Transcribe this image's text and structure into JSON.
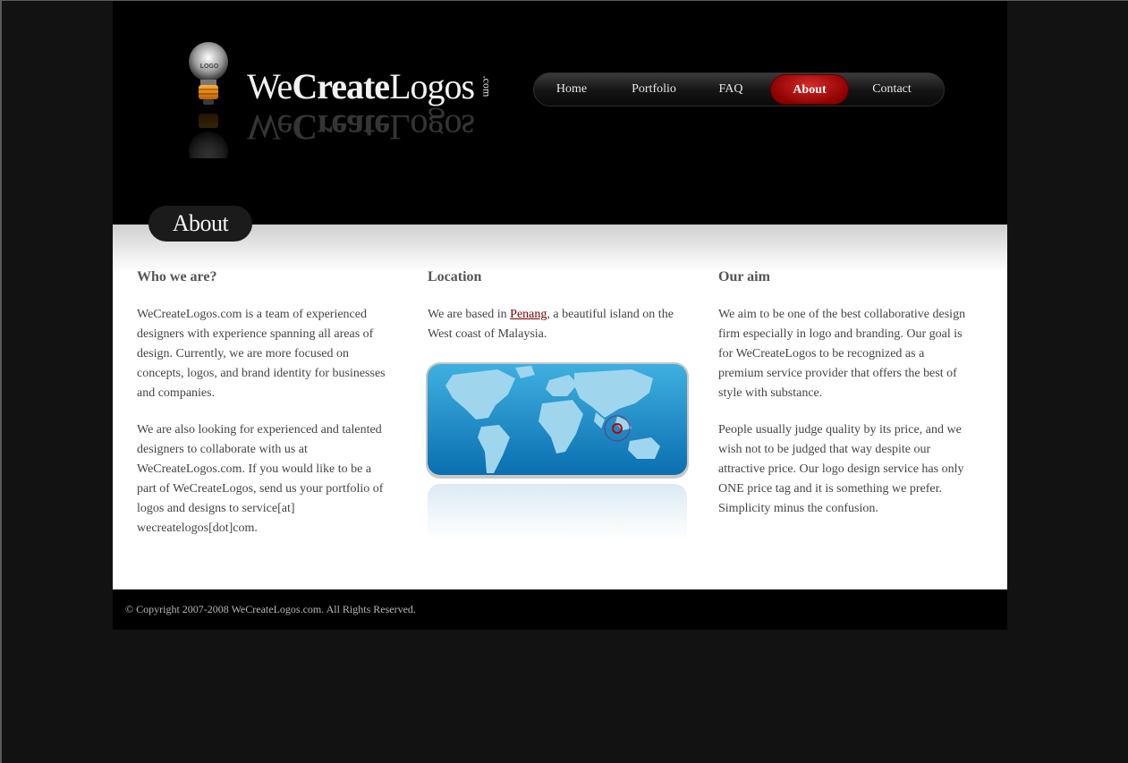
{
  "logo": {
    "text_regular_1": "We",
    "text_bold": "Create",
    "text_regular_2": "Logos",
    "text_com": ".com",
    "bulb_label": "LOGO"
  },
  "nav": {
    "items": [
      {
        "label": "Home"
      },
      {
        "label": "Portfolio"
      },
      {
        "label": "FAQ"
      },
      {
        "label": "About",
        "active": true
      },
      {
        "label": "Contact"
      }
    ]
  },
  "page_tab": "About",
  "columns": {
    "who": {
      "title": "Who we are?",
      "p1": "WeCreateLogos.com is a team of experienced designers with experience spanning all areas of design. Currently, we are more focused on concepts, logos, and brand identity for businesses and companies.",
      "p2": "We are also looking for experienced and talented designers to collaborate with us at WeCreateLogos.com. If you would like to be a part of WeCreateLogos, send us your portfolio of logos and designs to service[at] wecreatelogos[dot]com."
    },
    "location": {
      "title": "Location",
      "p1_before": "We are based in ",
      "p1_link": "Penang",
      "p1_after": ", a beautiful island on the West coast of Malaysia."
    },
    "aim": {
      "title": "Our aim",
      "p1": "We aim to be one of the best collaborative design firm especially in logo and branding. Our goal is for WeCreateLogos to be recognized as a premium service provider that offers the best of style with substance.",
      "p2": "People usually judge quality by its price, and we wish not to be judged that way despite our attractive price. Our logo design service has only ONE price tag and it is something we prefer. Simplicity minus the confusion."
    }
  },
  "footer": {
    "copyright": "© Copyright 2007-2008 WeCreateLogos.com. All Rights Reserved."
  },
  "colors": {
    "accent": "#a00000",
    "background": "#121212",
    "map_blue": "#2a9bd2"
  }
}
